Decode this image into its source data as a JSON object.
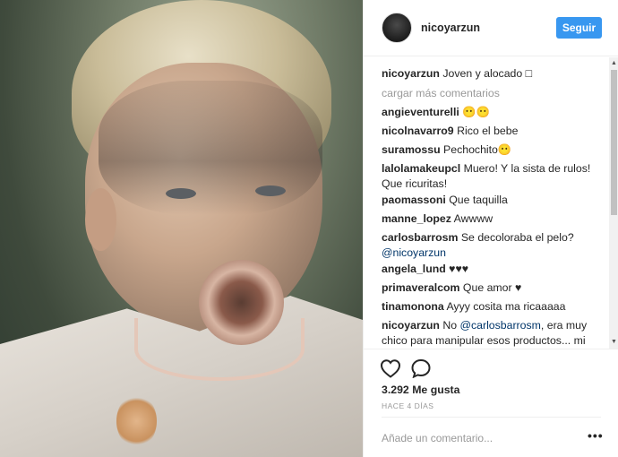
{
  "post": {
    "image_alt": "",
    "author": "nicoyarzun",
    "follow_label": "Seguir"
  },
  "caption": {
    "user": "nicoyarzun",
    "text": "Joven y alocado □"
  },
  "load_more_label": "cargar más comentarios",
  "comments": [
    {
      "user": "angieventurelli",
      "text": "😶😶"
    },
    {
      "user": "nicolnavarro9",
      "text": "Rico el bebe"
    },
    {
      "user": "suramossu",
      "text": "Pechochito😶"
    },
    {
      "user": "lalolamakeupcl",
      "text": "Muero! Y la sista de rulos!",
      "text2": "Que ricuritas!"
    },
    {
      "user": "paomassoni",
      "text": "Que taquilla"
    },
    {
      "user": "manne_lopez",
      "text": "Awwww"
    },
    {
      "user": "carlosbarrosm",
      "text": "Se decoloraba el pelo?",
      "mention": "@nicoyarzun"
    },
    {
      "user": "angela_lund",
      "text": "♥♥♥"
    },
    {
      "user": "primaveralcom",
      "text": "Que amor ♥"
    },
    {
      "user": "tinamonona",
      "text": "Ayyy cosita ma ricaaaaa"
    },
    {
      "user": "nicoyarzun",
      "prefix": "No",
      "mention": "@carlosbarrosm",
      "text": ", era muy",
      "text2": "chico para manipular esos productos... mi"
    }
  ],
  "likes": "3.292 Me gusta",
  "time_ago": "HACE 4 DÍAS",
  "add_comment_placeholder": "Añade un comentario...",
  "icons": {
    "like": "heart-icon",
    "comment": "comment-bubble-icon",
    "more": "more-options-icon"
  }
}
